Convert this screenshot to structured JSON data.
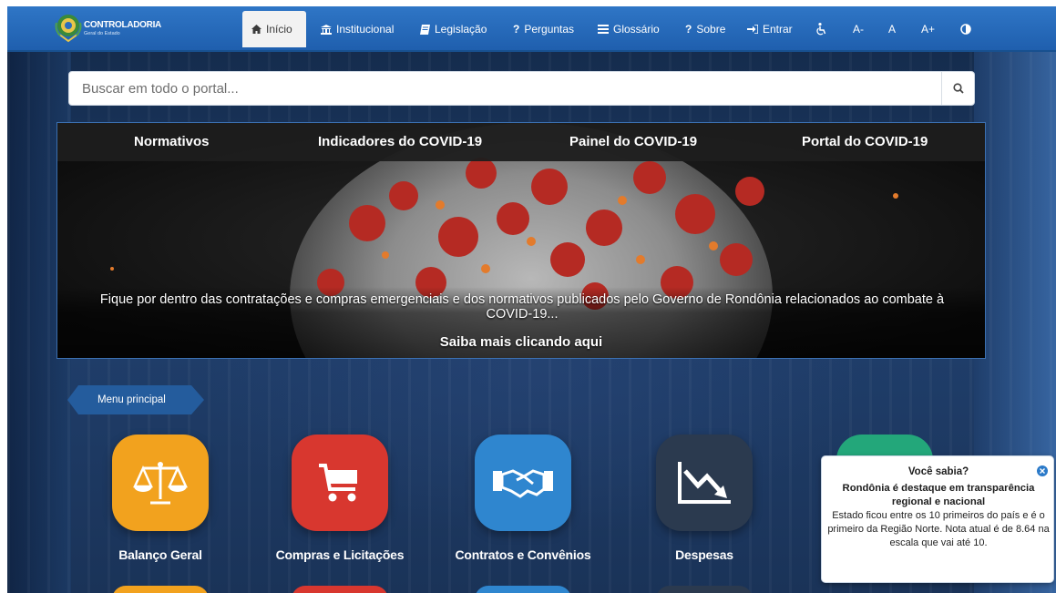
{
  "brand": {
    "title": "CONTROLADORIA",
    "subtitle": "Geral do Estado"
  },
  "nav": {
    "items": [
      {
        "label": "Início",
        "icon": "home-icon",
        "active": true
      },
      {
        "label": "Institucional",
        "icon": "institution-icon"
      },
      {
        "label": "Legislação",
        "icon": "book-icon"
      },
      {
        "label": "Perguntas",
        "icon": "question-icon"
      },
      {
        "label": "Glossário",
        "icon": "list-icon"
      },
      {
        "label": "Sobre",
        "icon": "question-icon"
      },
      {
        "label": "Entrar",
        "icon": "sign-in-icon"
      }
    ],
    "accessibility": {
      "font_decrease": "A-",
      "font_normal": "A",
      "font_increase": "A+"
    }
  },
  "search": {
    "placeholder": "Buscar em todo o portal..."
  },
  "banner": {
    "tabs": [
      "Normativos",
      "Indicadores do COVID-19",
      "Painel do COVID-19",
      "Portal do COVID-19"
    ],
    "text": "Fique por dentro das contratações e compras emergenciais e dos normativos publicados pelo Governo de Rondônia relacionados ao combate à COVID-19...",
    "cta": "Saiba mais clicando aqui"
  },
  "menu": {
    "label": "Menu principal",
    "tiles": [
      {
        "label": "Balanço Geral",
        "color": "#f2a21e",
        "icon": "scales-icon"
      },
      {
        "label": "Compras e Licitações",
        "color": "#d8372f",
        "icon": "cart-icon"
      },
      {
        "label": "Contratos e Convênios",
        "color": "#2f86cf",
        "icon": "handshake-icon"
      },
      {
        "label": "Despesas",
        "color": "#2b3a4f",
        "icon": "chart-down-icon"
      }
    ]
  },
  "popup": {
    "title": "Você sabia?",
    "headline": "Rondônia é destaque em transparência regional e nacional",
    "body": "Estado ficou entre os 10 primeiros do país e é o primeiro da Região Norte. Nota atual é de 8.64 na escala que vai até 10."
  },
  "colors": {
    "navbar": "#2a6dbf",
    "accent": "#2b7ac9"
  }
}
